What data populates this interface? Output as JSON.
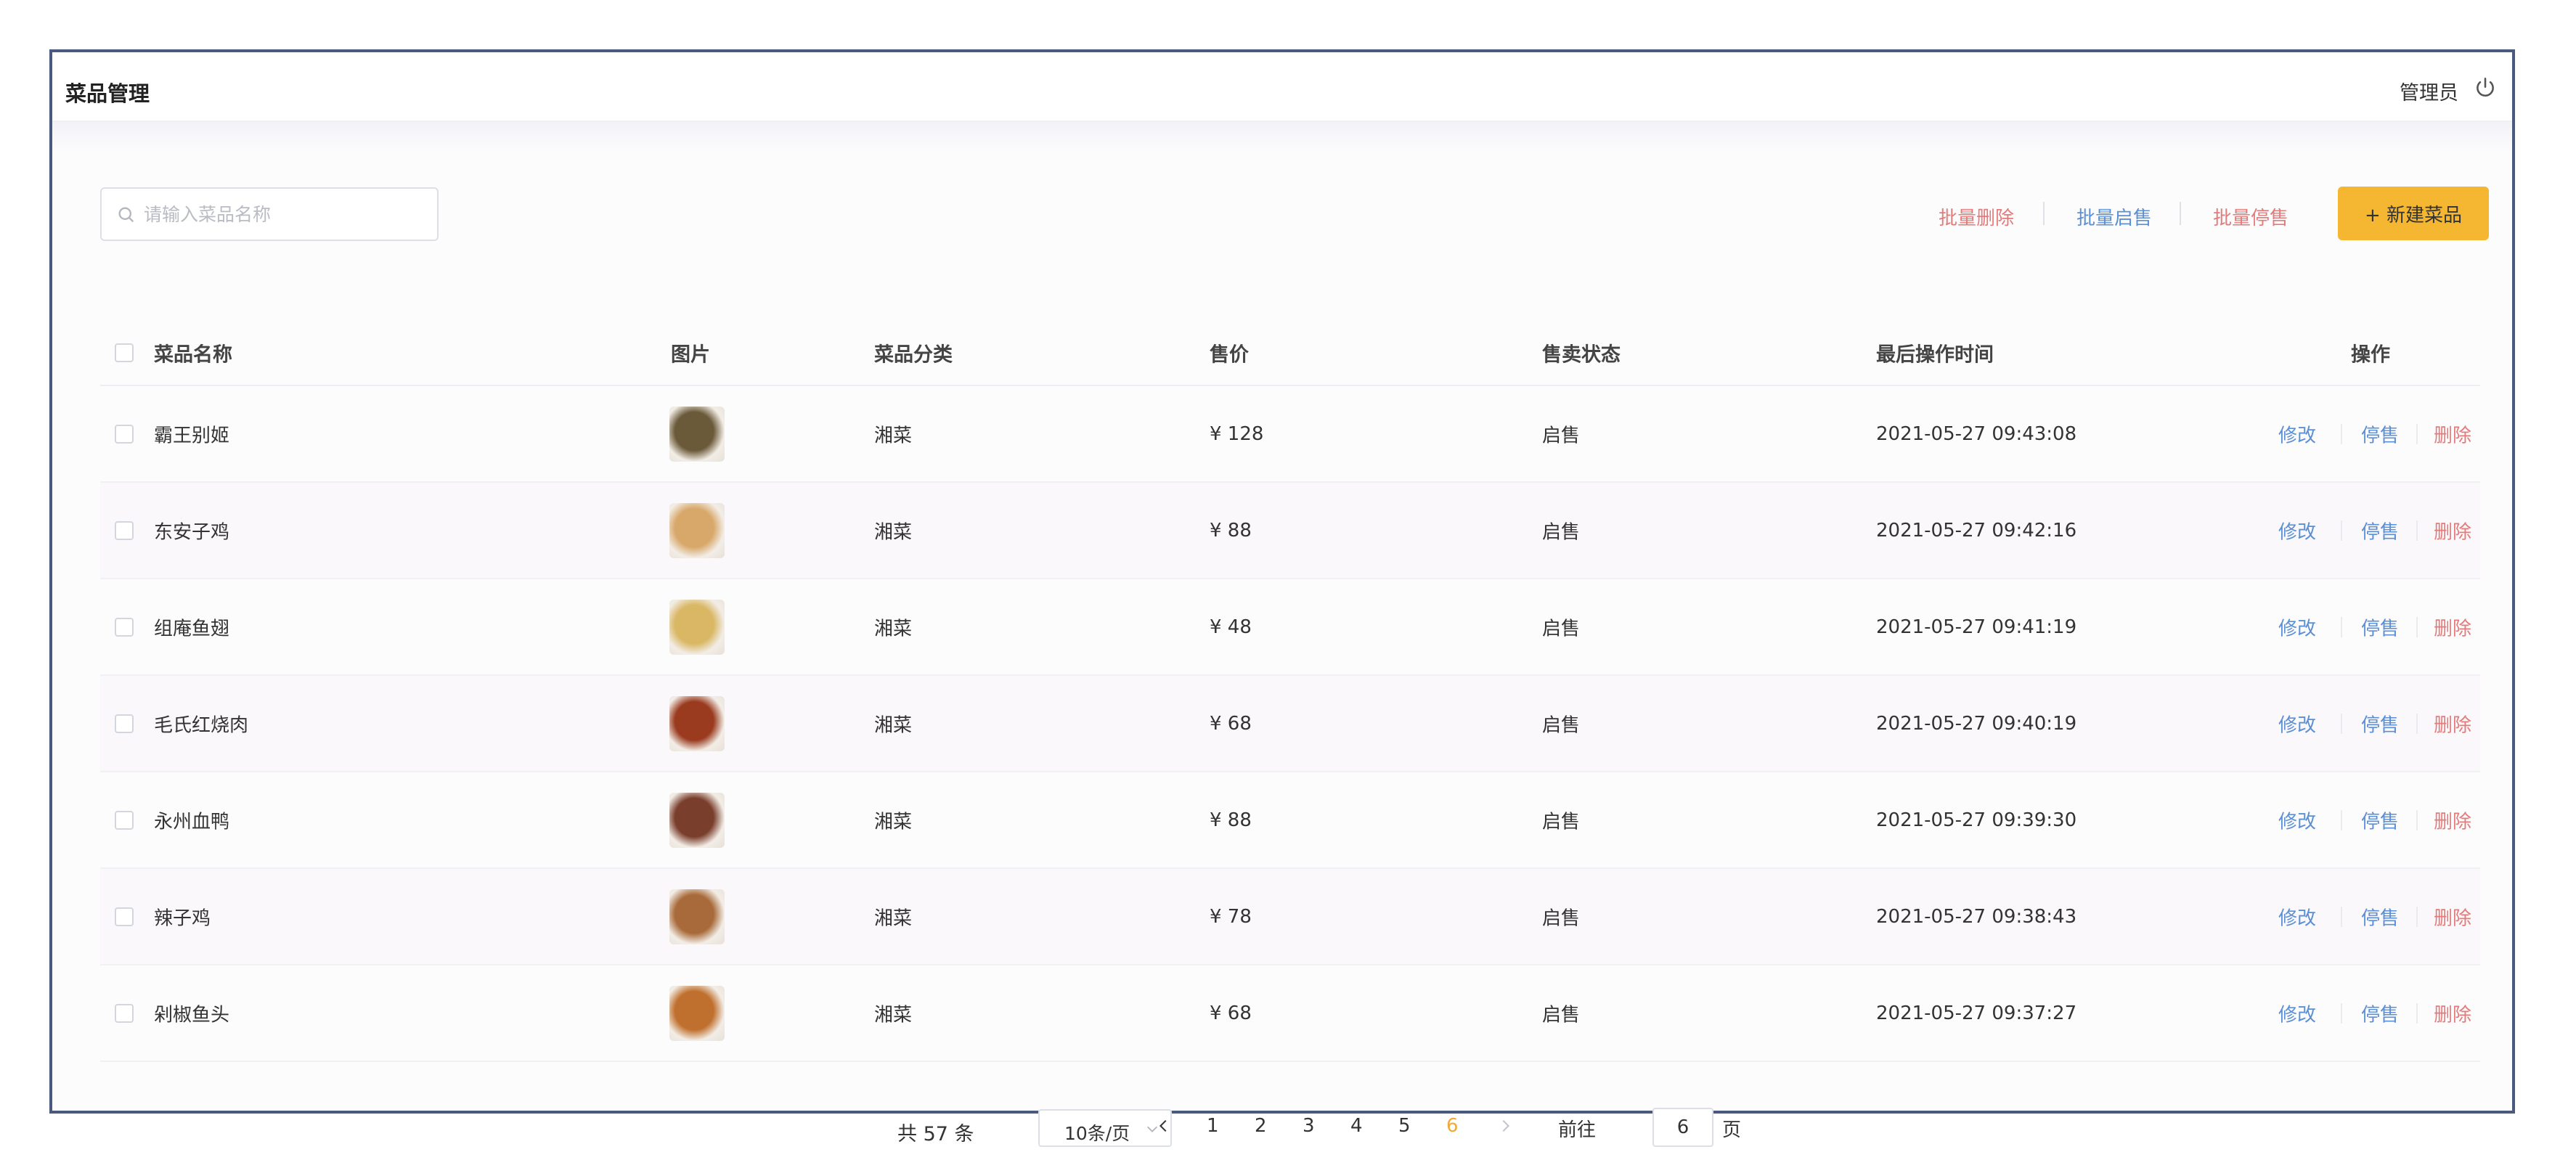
{
  "header": {
    "title": "菜品管理",
    "user": "管理员"
  },
  "toolbar": {
    "search_placeholder": "请输入菜品名称",
    "batch_delete": "批量删除",
    "batch_on_sale": "批量启售",
    "batch_stop_sale": "批量停售",
    "new_dish": "+ 新建菜品"
  },
  "table": {
    "columns": [
      "菜品名称",
      "图片",
      "菜品分类",
      "售价",
      "售卖状态",
      "最后操作时间",
      "操作"
    ],
    "rows": [
      {
        "name": "霸王别姬",
        "category": "湘菜",
        "price": "¥ 128",
        "status": "启售",
        "time": "2021-05-27 09:43:08",
        "img_color": "#6b5a3a"
      },
      {
        "name": "东安子鸡",
        "category": "湘菜",
        "price": "¥ 88",
        "status": "启售",
        "time": "2021-05-27 09:42:16",
        "img_color": "#d8a86a"
      },
      {
        "name": "组庵鱼翅",
        "category": "湘菜",
        "price": "¥ 48",
        "status": "启售",
        "time": "2021-05-27 09:41:19",
        "img_color": "#d9b764"
      },
      {
        "name": "毛氏红烧肉",
        "category": "湘菜",
        "price": "¥ 68",
        "status": "启售",
        "time": "2021-05-27 09:40:19",
        "img_color": "#9a3b1f"
      },
      {
        "name": "永州血鸭",
        "category": "湘菜",
        "price": "¥ 88",
        "status": "启售",
        "time": "2021-05-27 09:39:30",
        "img_color": "#7a3e2c"
      },
      {
        "name": "辣子鸡",
        "category": "湘菜",
        "price": "¥ 78",
        "status": "启售",
        "time": "2021-05-27 09:38:43",
        "img_color": "#a86a3a"
      },
      {
        "name": "剁椒鱼头",
        "category": "湘菜",
        "price": "¥ 68",
        "status": "启售",
        "time": "2021-05-27 09:37:27",
        "img_color": "#c0702e"
      }
    ],
    "row_actions": {
      "edit": "修改",
      "stop": "停售",
      "delete": "删除"
    }
  },
  "pagination": {
    "total_label": "共 57 条",
    "page_size": "10条/页",
    "pages": [
      "1",
      "2",
      "3",
      "4",
      "5",
      "6"
    ],
    "current_page": "6",
    "goto_prefix": "前往",
    "goto_value": "6",
    "goto_suffix": "页"
  },
  "colors": {
    "accent": "#f5b731",
    "link_blue": "#5b8fd6",
    "danger_red": "#e47b7b",
    "active_page": "#f1a938"
  }
}
